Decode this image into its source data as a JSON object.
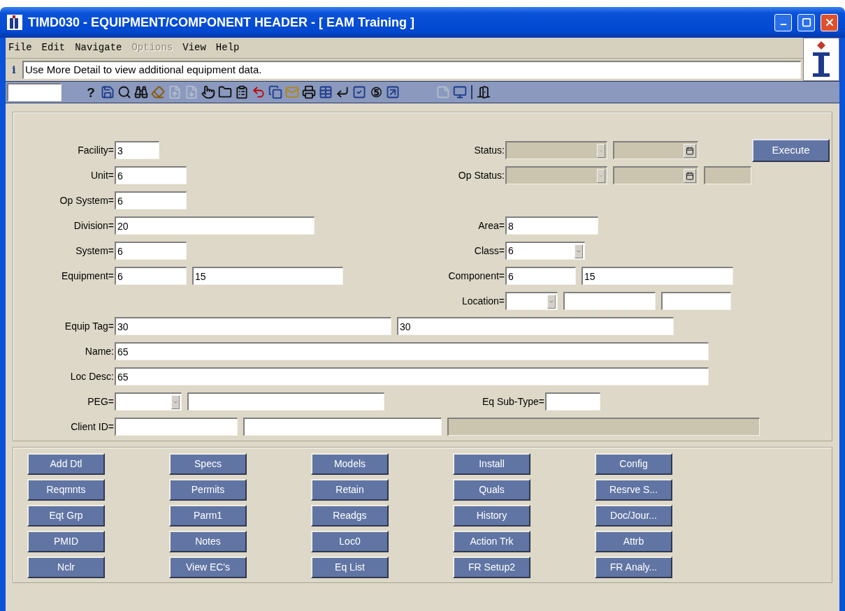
{
  "window": {
    "title": "TIMD030 - EQUIPMENT/COMPONENT HEADER - [ EAM Training ]"
  },
  "menu": [
    {
      "label": "File",
      "disabled": false
    },
    {
      "label": "Edit",
      "disabled": false
    },
    {
      "label": "Navigate",
      "disabled": false
    },
    {
      "label": "Options",
      "disabled": true
    },
    {
      "label": "View",
      "disabled": false
    },
    {
      "label": "Help",
      "disabled": false
    }
  ],
  "info": {
    "icon_text": "i",
    "message": "Use More Detail to view additional equipment data."
  },
  "toolbar": {
    "groups": [
      [
        {
          "kind": "glyph",
          "text": "?",
          "disabled": false
        },
        {
          "kind": "icon",
          "disabled": false
        },
        {
          "kind": "icon",
          "disabled": false
        },
        {
          "kind": "icon",
          "disabled": false
        },
        {
          "kind": "icon",
          "disabled": false
        },
        {
          "kind": "icon",
          "disabled": true
        },
        {
          "kind": "icon",
          "disabled": true
        },
        {
          "kind": "icon",
          "disabled": false
        },
        {
          "kind": "icon",
          "disabled": false
        },
        {
          "kind": "icon",
          "disabled": false
        },
        {
          "kind": "icon",
          "disabled": false
        },
        {
          "kind": "icon",
          "disabled": false
        },
        {
          "kind": "icon",
          "disabled": false
        },
        {
          "kind": "icon",
          "disabled": false
        },
        {
          "kind": "icon",
          "disabled": false
        },
        {
          "kind": "icon",
          "disabled": false
        },
        {
          "kind": "icon",
          "disabled": false
        },
        {
          "kind": "glyph",
          "text": "⑤",
          "disabled": false
        },
        {
          "kind": "icon",
          "disabled": false
        }
      ],
      [
        {
          "kind": "icon",
          "disabled": true
        },
        {
          "kind": "icon",
          "disabled": false
        }
      ],
      [
        {
          "kind": "icon",
          "disabled": false
        }
      ]
    ]
  },
  "form": {
    "rows": [
      {
        "left": {
          "label": "Facility=",
          "fields": [
            {
              "kind": "text",
              "value": "3",
              "disabled": false
            }
          ]
        },
        "right": {
          "label": "Status:",
          "fields": [
            {
              "kind": "dropdown",
              "disabled": true
            },
            {
              "kind": "date",
              "disabled": true
            }
          ]
        },
        "action": "Execute"
      },
      {
        "left": {
          "label": "Unit=",
          "fields": [
            {
              "kind": "text",
              "value": "6",
              "disabled": false
            }
          ]
        },
        "right": {
          "label": "Op Status:",
          "fields": [
            {
              "kind": "dropdown",
              "disabled": true
            },
            {
              "kind": "date",
              "disabled": true
            },
            {
              "kind": "text",
              "disabled": true
            }
          ]
        }
      },
      {
        "left": {
          "label": "Op System=",
          "fields": [
            {
              "kind": "text",
              "value": "6",
              "disabled": false
            }
          ]
        }
      },
      {
        "left": {
          "label": "Division=",
          "fields": [
            {
              "kind": "text",
              "value": "20",
              "disabled": false
            }
          ]
        },
        "right": {
          "label": "Area=",
          "fields": [
            {
              "kind": "text",
              "value": "8",
              "disabled": false
            }
          ]
        }
      },
      {
        "left": {
          "label": "System=",
          "fields": [
            {
              "kind": "text",
              "value": "6",
              "disabled": false
            }
          ]
        },
        "right": {
          "label": "Class=",
          "fields": [
            {
              "kind": "dropdown",
              "value": "6",
              "disabled": false
            }
          ]
        }
      },
      {
        "left": {
          "label": "Equipment=",
          "fields": [
            {
              "kind": "text",
              "value": "6",
              "disabled": false
            },
            {
              "kind": "text",
              "value": "15",
              "disabled": false
            }
          ]
        },
        "right": {
          "label": "Component=",
          "fields": [
            {
              "kind": "text",
              "value": "6",
              "disabled": false
            },
            {
              "kind": "text",
              "value": "15",
              "disabled": false
            }
          ]
        }
      },
      {
        "right": {
          "label": "Location=",
          "fields": [
            {
              "kind": "dropdown",
              "disabled": false
            },
            {
              "kind": "text",
              "disabled": false
            },
            {
              "kind": "text",
              "disabled": false
            }
          ]
        }
      },
      {
        "left": {
          "label": "Equip Tag=",
          "fields": [
            {
              "kind": "text",
              "value": "30",
              "disabled": false
            },
            {
              "kind": "text",
              "value": "30",
              "disabled": false
            }
          ]
        }
      },
      {
        "left": {
          "label": "Name:",
          "fields": [
            {
              "kind": "text",
              "value": "65",
              "disabled": false
            }
          ]
        }
      },
      {
        "left": {
          "label": "Loc Desc:",
          "fields": [
            {
              "kind": "text",
              "value": "65",
              "disabled": false
            }
          ]
        }
      },
      {
        "left": {
          "label": "PEG=",
          "fields": [
            {
              "kind": "dropdown",
              "disabled": false
            },
            {
              "kind": "text",
              "disabled": false
            }
          ]
        },
        "right": {
          "label": "Eq Sub-Type=",
          "fields": [
            {
              "kind": "text",
              "disabled": false
            }
          ]
        }
      },
      {
        "left": {
          "label": "Client ID=",
          "fields": [
            {
              "kind": "text",
              "disabled": false
            },
            {
              "kind": "text",
              "disabled": false
            },
            {
              "kind": "text",
              "disabled": true
            }
          ]
        }
      }
    ]
  },
  "buttons": [
    "Add Dtl",
    "Specs",
    "Models",
    "Install",
    "Config",
    "Reqmnts",
    "Permits",
    "Retain",
    "Quals",
    "Resrve S...",
    "Eqt Grp",
    "Parm1",
    "Readgs",
    "History",
    "Doc/Jour...",
    "PMID",
    "Notes",
    "Loc0",
    "Action Trk",
    "Attrb",
    "Nclr",
    "View EC's",
    "Eq List",
    "FR Setup2",
    "FR Analy..."
  ]
}
